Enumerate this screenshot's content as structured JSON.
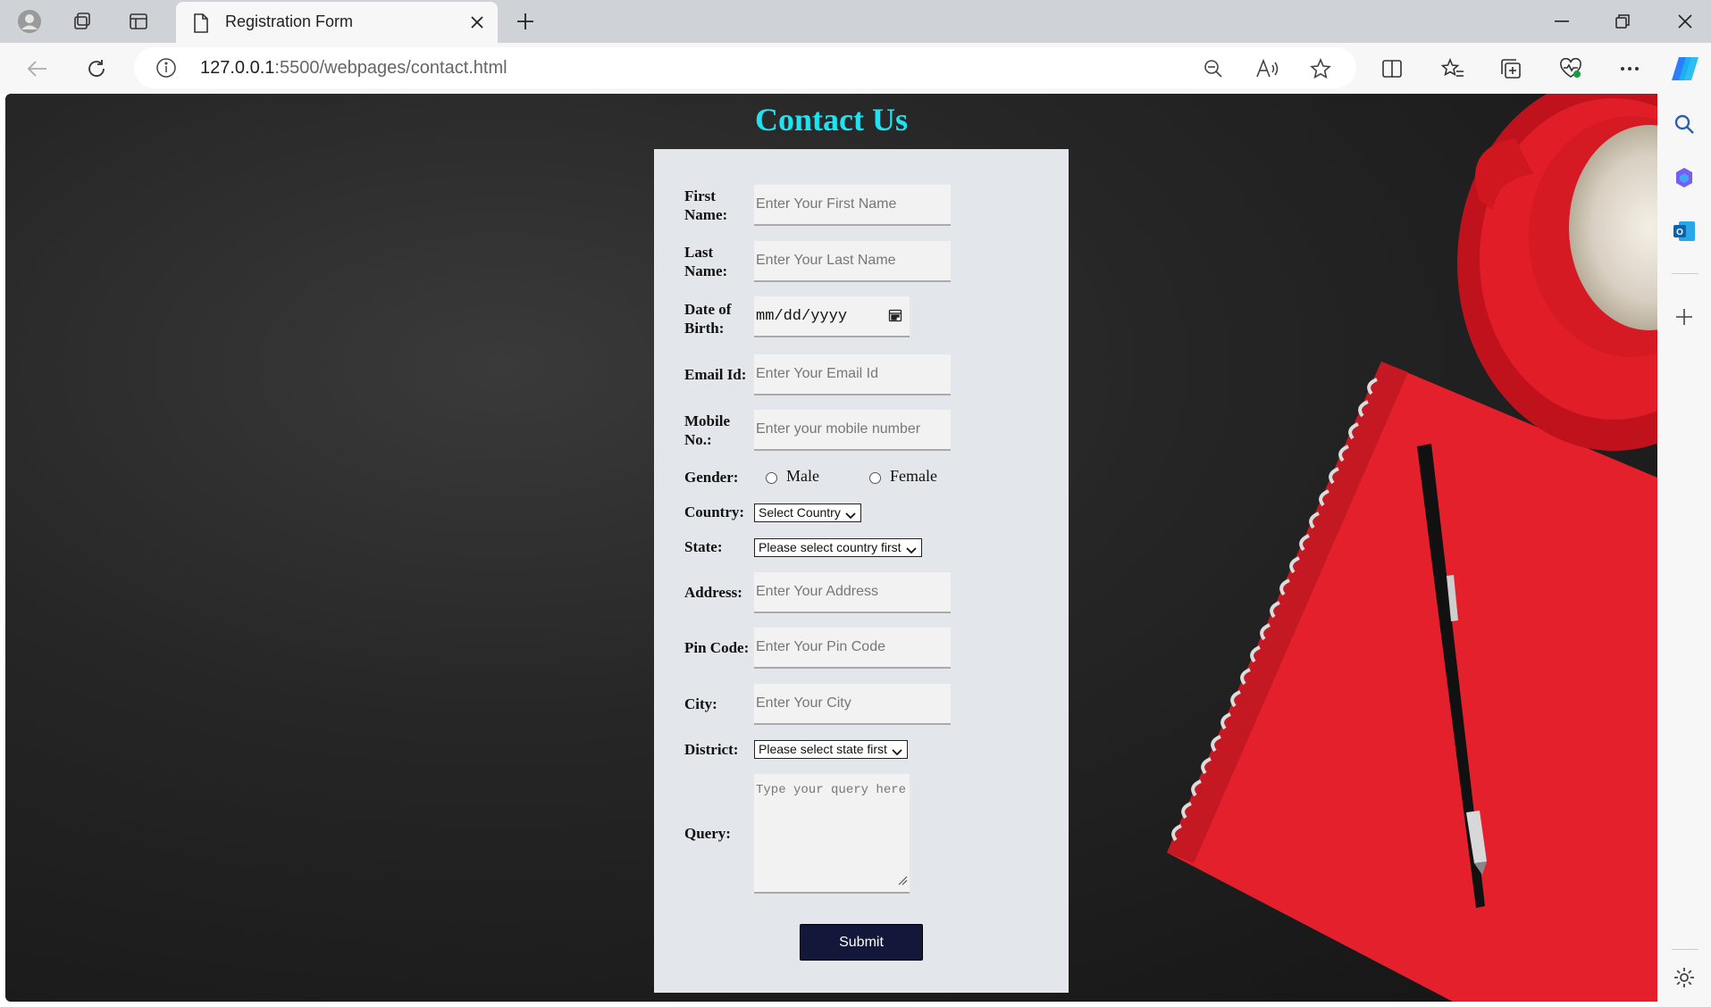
{
  "browser": {
    "tab_title": "Registration Form",
    "url_host": "127.0.0.1",
    "url_path": ":5500/webpages/contact.html"
  },
  "page": {
    "title": "Contact Us",
    "form": {
      "first_name": {
        "label": "First Name:",
        "placeholder": "Enter Your First Name"
      },
      "last_name": {
        "label": "Last Name:",
        "placeholder": "Enter Your Last Name"
      },
      "dob": {
        "label": "Date of Birth:",
        "value": "mm/dd/yyyy"
      },
      "email": {
        "label": "Email Id:",
        "placeholder": "Enter Your Email Id"
      },
      "mobile": {
        "label": "Mobile No.:",
        "placeholder": "Enter your mobile number"
      },
      "gender": {
        "label": "Gender:",
        "options": [
          "Male",
          "Female"
        ]
      },
      "country": {
        "label": "Country:",
        "selected": "Select Country"
      },
      "state": {
        "label": "State:",
        "selected": "Please select country first"
      },
      "address": {
        "label": "Address:",
        "placeholder": "Enter Your Address"
      },
      "pin": {
        "label": "Pin Code:",
        "placeholder": "Enter Your Pin Code"
      },
      "city": {
        "label": "City:",
        "placeholder": "Enter Your City"
      },
      "district": {
        "label": "District:",
        "selected": "Please select state first"
      },
      "query": {
        "label": "Query:",
        "placeholder": "Type your query here"
      },
      "submit_label": "Submit"
    }
  },
  "colors": {
    "title": "#1ee3f0",
    "form_bg": "#e3e6ea",
    "submit_bg": "#13183a",
    "notebook": "#e3202c"
  }
}
